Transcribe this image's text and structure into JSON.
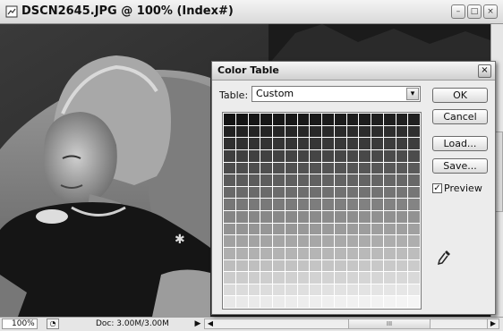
{
  "window": {
    "title": "DSCN2645.JPG @ 100% (Index#)",
    "controls": {
      "minimize": "–",
      "restore": "□",
      "close": "×"
    }
  },
  "status_bar": {
    "zoom": "100%",
    "doc_info": "Doc: 3.00M/3.00M",
    "arrow": "▶",
    "scroll_left": "◀",
    "scroll_right": "▶",
    "scroll_thumb_grip": "III"
  },
  "dialog": {
    "title": "Color Table",
    "close": "×",
    "table_label": "Table:",
    "table_value": "Custom",
    "dropdown_arrow": "▾",
    "buttons": {
      "ok": "OK",
      "cancel": "Cancel",
      "load": "Load...",
      "save": "Save..."
    },
    "preview_label": "Preview",
    "preview_checked": true,
    "check_mark": "✓"
  },
  "icons": {
    "doc_icon": "photoshop-doc-icon",
    "eyedropper": "eyedropper-icon"
  }
}
